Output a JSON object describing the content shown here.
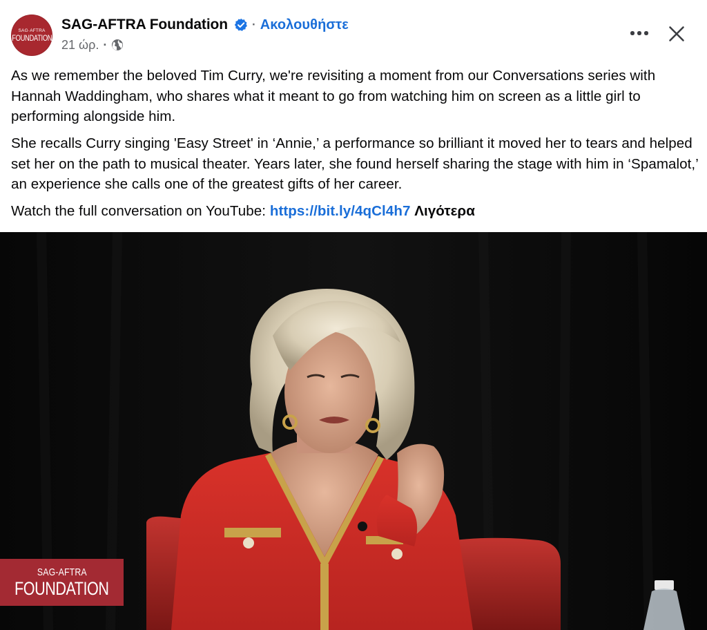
{
  "post": {
    "page_name": "SAG-AFTRA Foundation",
    "avatar_text_top": "SAG·AFTRA",
    "avatar_text_bottom": "FOUNDATION",
    "separator": "·",
    "follow_label": "Ακολουθήστε",
    "timestamp": "21 ώρ.",
    "meta_separator": "·",
    "icons": {
      "verified": "verified-badge-icon",
      "privacy": "globe-icon",
      "more": "more-options-icon",
      "close": "close-icon"
    }
  },
  "caption": {
    "paragraph_1": "As we remember the beloved Tim Curry, we're revisiting a moment from our Conversations series with Hannah Waddingham, who shares what it meant to go from watching him on screen as a little girl to performing alongside him.",
    "paragraph_2": "She recalls Curry singing 'Easy Street' in ‘Annie,’ a performance so brilliant it moved her to tears and helped set her on the path to musical theater. Years later, she found herself sharing the stage with him in ‘Spamalot,’ an experience she calls one of the greatest gifts of her career.",
    "paragraph_3_prefix": "Watch the full conversation on YouTube: ",
    "link_text": "https://bit.ly/4qCl4h7",
    "see_more_label": "Λιγότερα"
  },
  "video": {
    "watermark_top": "SAG-AFTRA",
    "watermark_bottom": "FOUNDATION"
  },
  "colors": {
    "link_blue": "#1a6ed8",
    "brand_red": "#a32a33",
    "secondary_text": "#65676b",
    "primary_text": "#080809",
    "verified_blue": "#1b74e4"
  }
}
